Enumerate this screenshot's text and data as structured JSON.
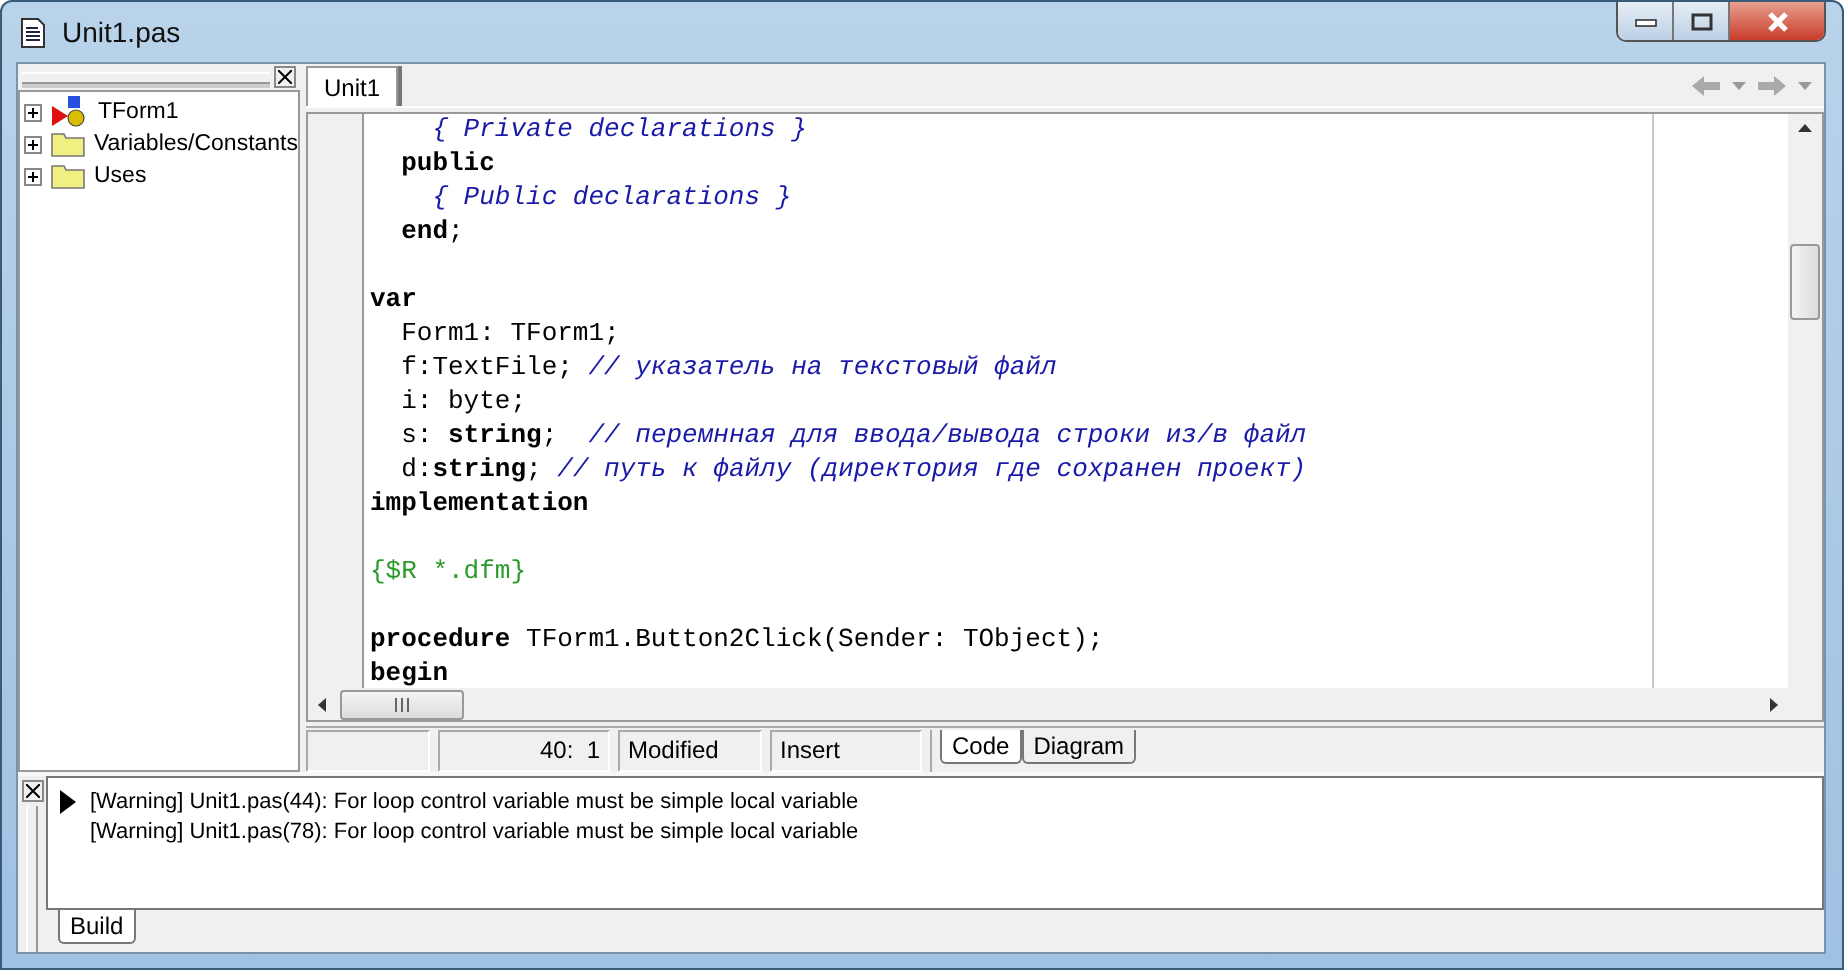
{
  "window": {
    "title": "Unit1.pas"
  },
  "structure_tree": [
    {
      "label": "TForm1",
      "kind": "class",
      "expanded": false
    },
    {
      "label": "Variables/Constants",
      "kind": "folder",
      "expanded": false
    },
    {
      "label": "Uses",
      "kind": "folder",
      "expanded": false
    }
  ],
  "editor_tabs": [
    {
      "label": "Unit1",
      "selected": true
    }
  ],
  "code_lines": [
    {
      "segments": [
        {
          "kind": "comment",
          "text": "    { Private declarations }"
        }
      ]
    },
    {
      "segments": [
        {
          "kind": "keyword",
          "text": "  public"
        }
      ]
    },
    {
      "segments": [
        {
          "kind": "comment",
          "text": "    { Public declarations }"
        }
      ]
    },
    {
      "segments": [
        {
          "kind": "keyword",
          "text": "  end"
        },
        {
          "kind": "text",
          "text": ";"
        }
      ]
    },
    {
      "kind": "blank"
    },
    {
      "segments": [
        {
          "kind": "keyword",
          "text": "var"
        }
      ]
    },
    {
      "segments": [
        {
          "kind": "text",
          "text": "  Form1: TForm1;"
        }
      ]
    },
    {
      "segments": [
        {
          "kind": "text",
          "text": "  f:TextFile; "
        },
        {
          "kind": "comment",
          "text": "// указатель на текстовый файл"
        }
      ]
    },
    {
      "segments": [
        {
          "kind": "text",
          "text": "  i: byte;"
        }
      ]
    },
    {
      "segments": [
        {
          "kind": "text",
          "text": "  s: "
        },
        {
          "kind": "keyword",
          "text": "string"
        },
        {
          "kind": "text",
          "text": ";  "
        },
        {
          "kind": "comment",
          "text": "// перемнная для ввода/вывода строки из/в файл"
        }
      ]
    },
    {
      "segments": [
        {
          "kind": "text",
          "text": "  d:"
        },
        {
          "kind": "keyword",
          "text": "string"
        },
        {
          "kind": "text",
          "text": "; "
        },
        {
          "kind": "comment",
          "text": "// путь к файлу (директория где сохранен проект)"
        }
      ]
    },
    {
      "segments": [
        {
          "kind": "keyword",
          "text": "implementation"
        }
      ]
    },
    {
      "kind": "blank"
    },
    {
      "segments": [
        {
          "kind": "directive",
          "text": "{$R *.dfm}"
        }
      ]
    },
    {
      "kind": "blank"
    },
    {
      "segments": [
        {
          "kind": "keyword",
          "text": "procedure"
        },
        {
          "kind": "text",
          "text": " TForm1.Button2Click(Sender: TObject);"
        }
      ]
    },
    {
      "segments": [
        {
          "kind": "keyword",
          "text": "begin"
        }
      ]
    }
  ],
  "status_bar": {
    "cells": [
      {
        "kind": "empty"
      },
      {
        "text": "40:  1"
      },
      {
        "text": "Modified"
      },
      {
        "text": "Insert"
      }
    ],
    "view_tabs": [
      {
        "label": "Code",
        "selected": true
      },
      {
        "label": "Diagram",
        "selected": false
      }
    ]
  },
  "messages": [
    {
      "text": "[Warning] Unit1.pas(44): For loop control variable must be simple local variable",
      "selected": true
    },
    {
      "text": "[Warning] Unit1.pas(78): For loop control variable must be simple local variable",
      "selected": false
    }
  ],
  "message_tabs": [
    {
      "label": "Build",
      "selected": true
    }
  ]
}
